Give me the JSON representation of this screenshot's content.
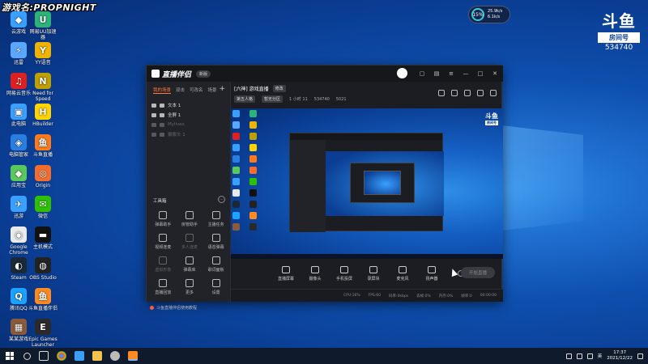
{
  "watermark": "游戏名:PROPNIGHT",
  "desktop_icons": [
    {
      "label": "云游戏",
      "color": "#3aa0ff",
      "glyph": "◆"
    },
    {
      "label": "网易UU加速器",
      "color": "#2bb37a",
      "glyph": "U"
    },
    {
      "label": "迅雷",
      "color": "#5aa7ff",
      "glyph": "⚡"
    },
    {
      "label": "YY语音",
      "color": "#f0b400",
      "glyph": "Y"
    },
    {
      "label": "网易云音乐",
      "color": "#e02020",
      "glyph": "♫"
    },
    {
      "label": "Need for Speed",
      "color": "#c0a000",
      "glyph": "N"
    },
    {
      "label": "此电脑",
      "color": "#3aa0ff",
      "glyph": "▣"
    },
    {
      "label": "HBuilder",
      "color": "#ffd400",
      "glyph": "H"
    },
    {
      "label": "电脑管家",
      "color": "#2a7de1",
      "glyph": "◈"
    },
    {
      "label": "斗鱼直播",
      "color": "#ff7a1a",
      "glyph": "鱼"
    },
    {
      "label": "应用宝",
      "color": "#5ac85a",
      "glyph": "◆"
    },
    {
      "label": "Origin",
      "color": "#f56c2d",
      "glyph": "◎"
    },
    {
      "label": "迅游",
      "color": "#3aa0ff",
      "glyph": "✈"
    },
    {
      "label": "微信",
      "color": "#2dc100",
      "glyph": "✉"
    },
    {
      "label": "Google Chrome",
      "color": "#eaeaea",
      "glyph": "◉"
    },
    {
      "label": "主机模式",
      "color": "#111111",
      "glyph": "▬"
    },
    {
      "label": "Steam",
      "color": "#1b2838",
      "glyph": "◐"
    },
    {
      "label": "OBS Studio",
      "color": "#222222",
      "glyph": "◍"
    },
    {
      "label": "腾讯QQ",
      "color": "#1aa3ff",
      "glyph": "Q"
    },
    {
      "label": "斗鱼直播伴侣",
      "color": "#ff8a20",
      "glyph": "鱼"
    },
    {
      "label": "某某游戏",
      "color": "#8a5a3a",
      "glyph": "▦"
    },
    {
      "label": "Epic Games Launcher",
      "color": "#2a2a2a",
      "glyph": "E"
    }
  ],
  "perf": {
    "percent": "15%",
    "up": "25.9k/s",
    "down": "6.1k/s"
  },
  "douyu_logo": {
    "mark": "斗鱼",
    "tag": "房间号",
    "room_id": "534740"
  },
  "app": {
    "title": "直播伴侣",
    "version_pill": "新版",
    "scene_tabs": [
      "我的场景",
      "双击",
      "可改名",
      "场景"
    ],
    "sources": [
      {
        "label": "文本 1",
        "dim": false
      },
      {
        "label": "全屏 1",
        "dim": false
      },
      {
        "label": "Mylives",
        "dim": true
      },
      {
        "label": "摄像头 1",
        "dim": true
      }
    ],
    "toolbox_label": "工具箱",
    "tools": [
      {
        "label": "弹幕助手",
        "dim": false
      },
      {
        "label": "房管助手",
        "dim": false
      },
      {
        "label": "主播任务",
        "dim": false
      },
      {
        "label": "视频连麦",
        "dim": false
      },
      {
        "label": "多人连麦",
        "dim": true
      },
      {
        "label": "语音弹幕",
        "dim": false
      },
      {
        "label": "虚拟形象",
        "dim": true
      },
      {
        "label": "弹幕库",
        "dim": false
      },
      {
        "label": "歌词面板",
        "dim": false
      },
      {
        "label": "直播回放",
        "dim": false
      },
      {
        "label": "更多",
        "dim": false
      },
      {
        "label": "设置",
        "dim": false
      }
    ],
    "notice": "斗鱼直播伴侣使用教程",
    "room_title": "[六神] 游戏直播",
    "room_badge": "修改",
    "room_category": "第五人格",
    "room_sub": "暂无分区",
    "room_stats": [
      "1 小时 11",
      "534740",
      "5021"
    ],
    "controls": [
      {
        "label": "直播屏幕"
      },
      {
        "label": "摄像头"
      },
      {
        "label": "手机投屏"
      },
      {
        "label": "录屏块"
      },
      {
        "label": "麦克风"
      },
      {
        "label": "扬声器"
      }
    ],
    "start_live": "开始直播",
    "status_items": [
      "CPU:16%",
      "FPS:60",
      "码率:0kbps",
      "丢帧:0%",
      "内存:0%",
      "帧率:0",
      "00:00:00"
    ]
  },
  "taskbar": {
    "tray_text": "英",
    "time": "17:37",
    "date": "2021/12/22"
  }
}
